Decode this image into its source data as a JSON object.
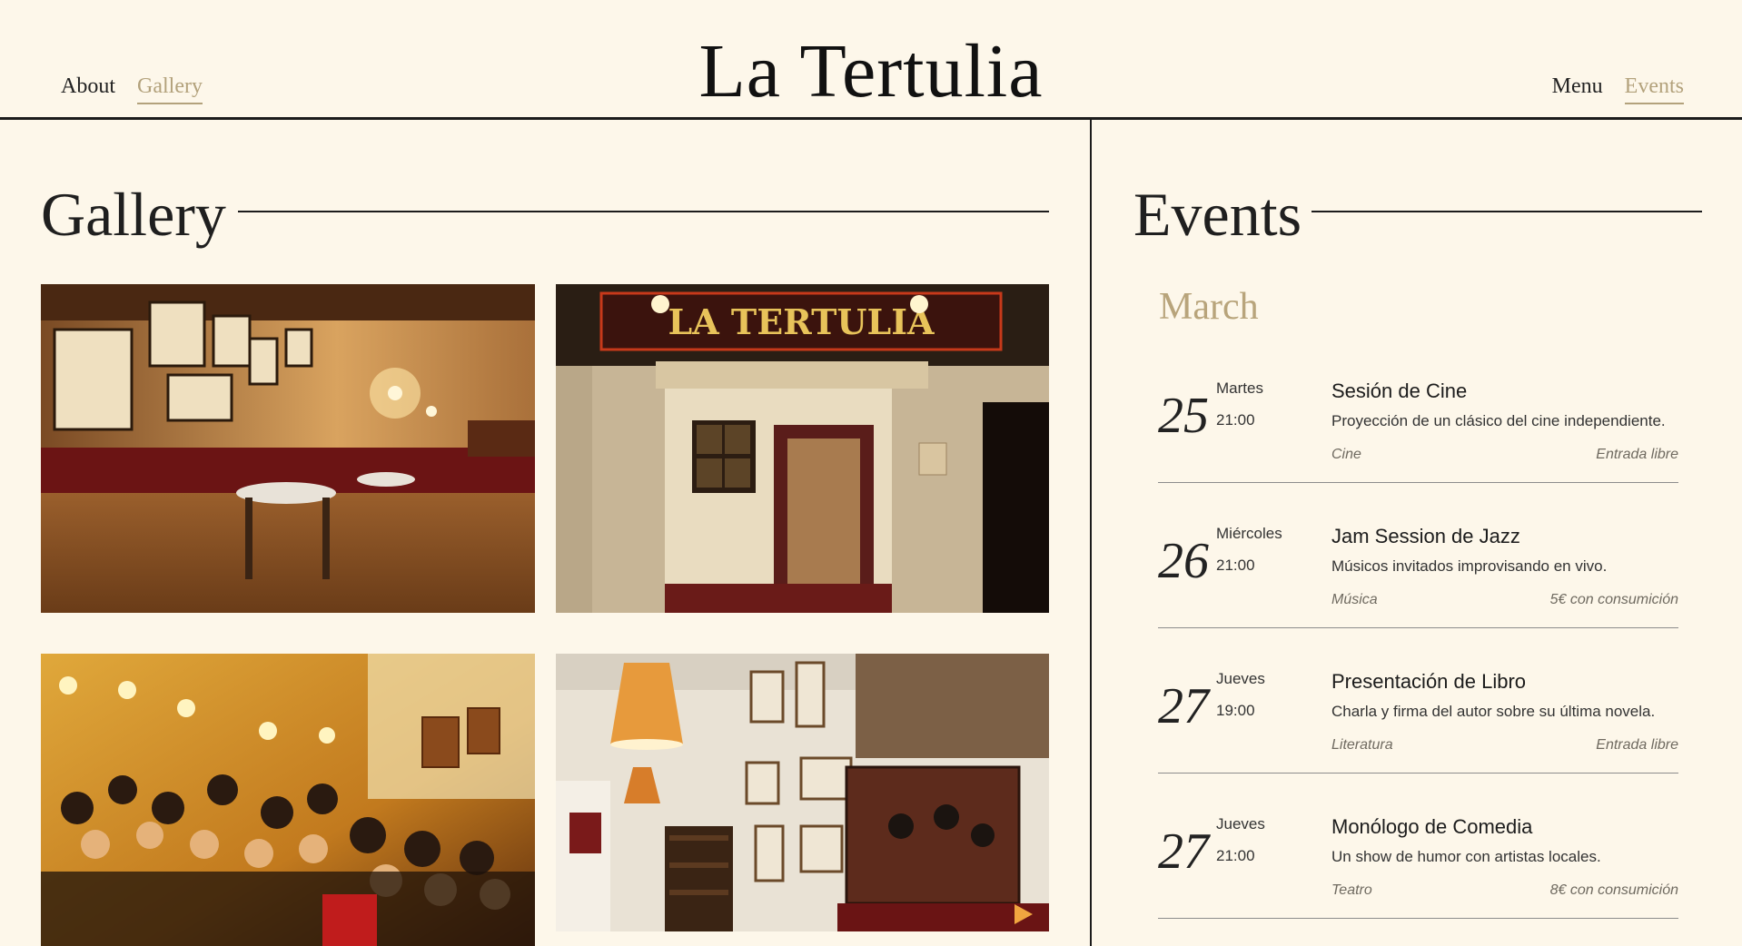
{
  "header": {
    "brand": "La Tertulia",
    "nav_left": [
      {
        "label": "About",
        "active": false
      },
      {
        "label": "Gallery",
        "active": true
      }
    ],
    "nav_right": [
      {
        "label": "Menu",
        "active": false
      },
      {
        "label": "Events",
        "active": true
      }
    ]
  },
  "gallery": {
    "title": "Gallery",
    "photos": [
      {
        "name": "bar-interior-photo"
      },
      {
        "name": "storefront-entrance-photo",
        "sign_text": "LA TERTULIA"
      },
      {
        "name": "crowd-event-photo"
      },
      {
        "name": "wall-art-lamp-photo"
      }
    ]
  },
  "events": {
    "title": "Events",
    "month": "March",
    "items": [
      {
        "day": "25",
        "weekday": "Martes",
        "time": "21:00",
        "name": "Sesión de Cine",
        "description": "Proyección de un clásico del cine independiente.",
        "category": "Cine",
        "price": "Entrada libre"
      },
      {
        "day": "26",
        "weekday": "Miércoles",
        "time": "21:00",
        "name": "Jam Session de Jazz",
        "description": "Músicos invitados improvisando en vivo.",
        "category": "Música",
        "price": "5€ con consumición"
      },
      {
        "day": "27",
        "weekday": "Jueves",
        "time": "19:00",
        "name": "Presentación de Libro",
        "description": "Charla y firma del autor sobre su última novela.",
        "category": "Literatura",
        "price": "Entrada libre"
      },
      {
        "day": "27",
        "weekday": "Jueves",
        "time": "21:00",
        "name": "Monólogo de Comedia",
        "description": "Un show de humor con artistas locales.",
        "category": "Teatro",
        "price": "8€ con consumición"
      }
    ]
  },
  "colors": {
    "background": "#fdf7ea",
    "accent": "#b3a27c",
    "text": "#1c1c1c"
  }
}
